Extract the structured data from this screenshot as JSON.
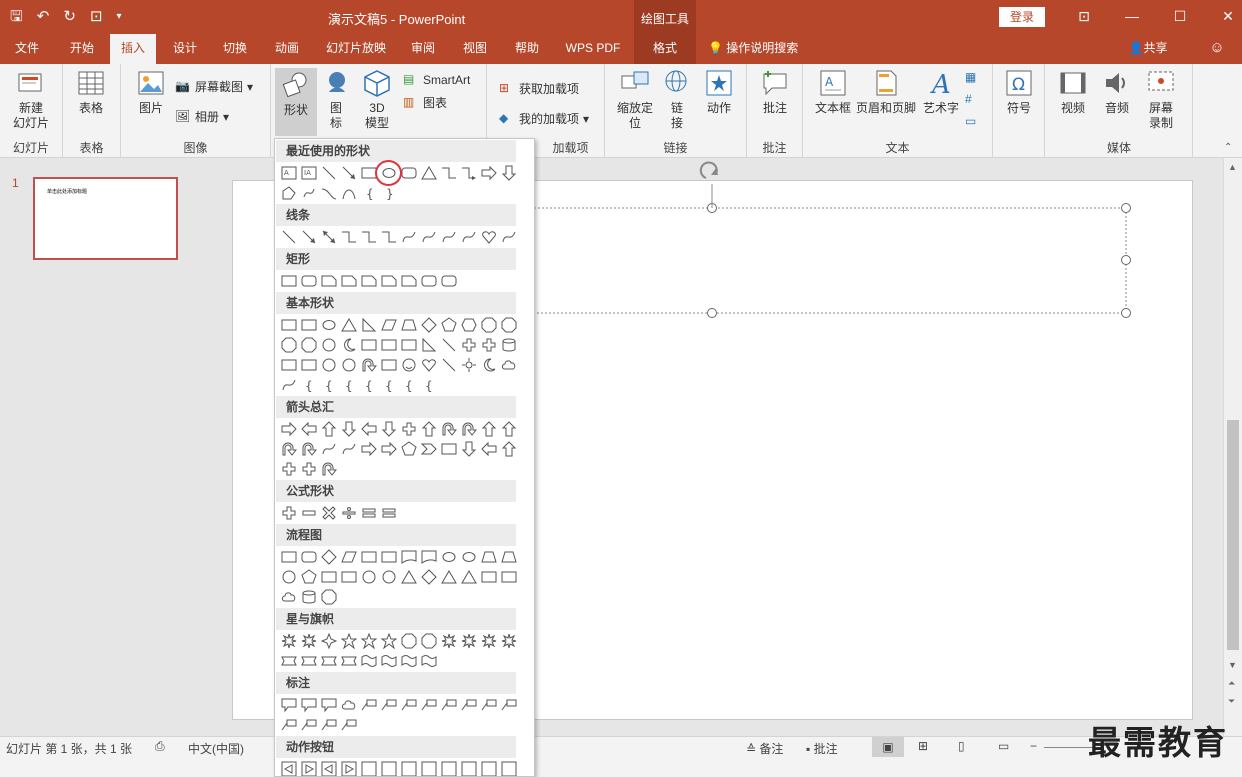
{
  "window": {
    "doc_title": "演示文稿5  -  PowerPoint",
    "context_tab_header": "绘图工具",
    "login": "登录"
  },
  "tabs": [
    {
      "label": "文件"
    },
    {
      "label": "开始"
    },
    {
      "label": "插入"
    },
    {
      "label": "设计"
    },
    {
      "label": "切换"
    },
    {
      "label": "动画"
    },
    {
      "label": "幻灯片放映"
    },
    {
      "label": "审阅"
    },
    {
      "label": "视图"
    },
    {
      "label": "帮助"
    },
    {
      "label": "WPS PDF"
    },
    {
      "label": "格式"
    }
  ],
  "tell_me": "操作说明搜索",
  "share": "共享",
  "ribbon": {
    "new_slide": "新建\n幻灯片",
    "group_slides": "幻灯片",
    "table": "表格",
    "group_table": "表格",
    "picture": "图片",
    "screenshot": "屏幕截图",
    "album": "相册",
    "group_images": "图像",
    "shapes": "形状",
    "icons": "图\n标",
    "model3d": "3D\n模型",
    "smartart": "SmartArt",
    "chart": "图表",
    "get_addins": "获取加载项",
    "my_addins": "我的加载项",
    "group_addins": "加载项",
    "zoom": "缩放定\n位",
    "link": "链\n接",
    "action": "动作",
    "group_links": "链接",
    "comment": "批注",
    "group_comments": "批注",
    "textbox": "文本框",
    "header_footer": "页眉和页脚",
    "wordart": "艺术字",
    "symbol": "符号",
    "group_text": "文本",
    "video": "视频",
    "audio": "音频",
    "screen_record": "屏幕\n录制",
    "group_media": "媒体"
  },
  "thumbnail": {
    "number": "1",
    "text": "单击此处添加标题"
  },
  "gallery": {
    "sections": [
      "最近使用的形状",
      "线条",
      "矩形",
      "基本形状",
      "箭头总汇",
      "公式形状",
      "流程图",
      "星与旗帜",
      "标注",
      "动作按钮"
    ]
  },
  "status": {
    "slide_info": "幻灯片 第 1 张，共 1 张",
    "language": "中文(中国)",
    "notes": "备注",
    "comments": "批注"
  },
  "watermark": "最需教育",
  "colors": {
    "accent": "#b7472a",
    "highlight": "#e0333b"
  }
}
